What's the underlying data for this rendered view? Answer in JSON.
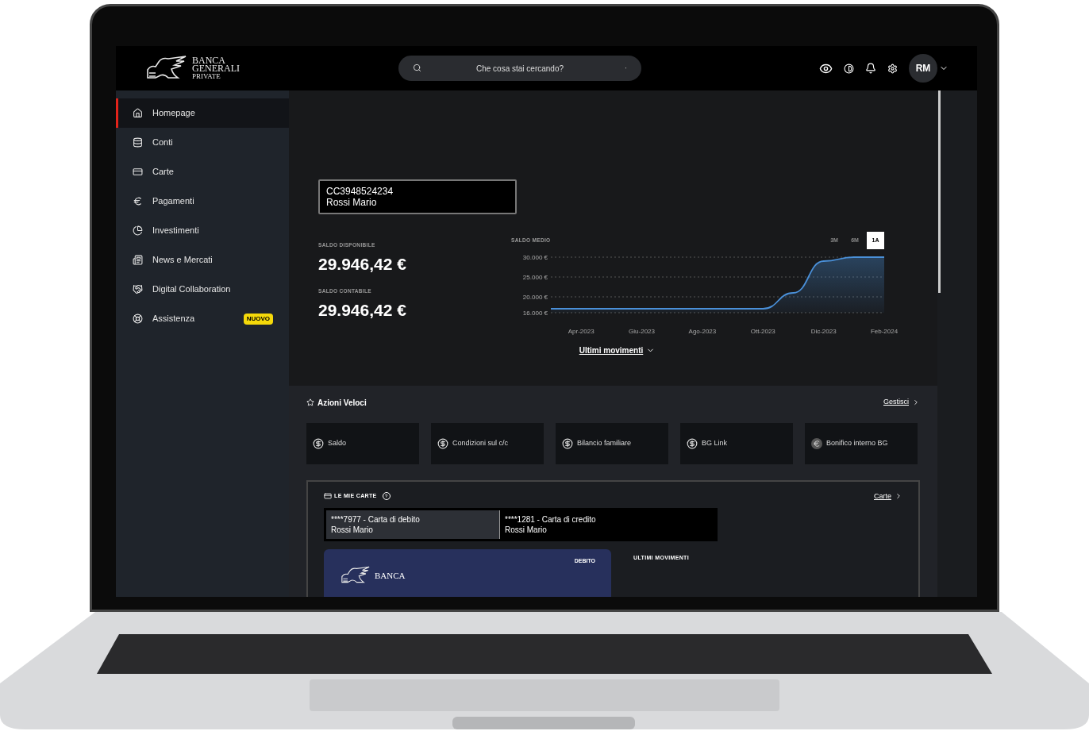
{
  "header": {
    "logo_lines": [
      "BANCA",
      "GENERALI",
      "PRIVATE"
    ],
    "search": {
      "placeholder": "Che cosa stai cercando?",
      "dot": "·"
    },
    "avatar": "RM"
  },
  "sidebar": {
    "items": [
      {
        "label": "Homepage",
        "selected": true
      },
      {
        "label": "Conti",
        "selected": false
      },
      {
        "label": "Carte",
        "selected": false
      },
      {
        "label": "Pagamenti",
        "selected": false
      },
      {
        "label": "Investimenti",
        "selected": false
      },
      {
        "label": "News e Mercati",
        "selected": false
      },
      {
        "label": "Digital Collaboration",
        "selected": false
      },
      {
        "label": "Assistenza",
        "selected": false,
        "badge": "NUOVO"
      }
    ]
  },
  "account": {
    "number": "CC3948524234",
    "holder": "Rossi Mario",
    "balances": [
      {
        "label": "SALDO DISPONIBILE",
        "value": "29.946,42 €"
      },
      {
        "label": "SALDO CONTABILE",
        "value": "29.946,42 €"
      }
    ],
    "chart_title": "SALDO MEDIO",
    "ranges": [
      {
        "label": "3M",
        "selected": false
      },
      {
        "label": "6M",
        "selected": false
      },
      {
        "label": "1A",
        "selected": true
      }
    ],
    "chart_data": {
      "type": "area",
      "categories": [
        null,
        "Apr-2023",
        null,
        "Giu-2023",
        null,
        "Ago-2023",
        null,
        "Ott-2023",
        null,
        "Dic-2023",
        null,
        "Feb-2024"
      ],
      "series": [
        {
          "color": "#4a90d9",
          "values": [
            17000,
            17000,
            17000,
            17000,
            17000,
            17000,
            17000,
            17000,
            21000,
            29000,
            30000,
            30000
          ]
        }
      ],
      "ylim": [
        16000,
        30000
      ],
      "yticks": [
        {
          "value": 16000,
          "label": "16.000 €"
        },
        {
          "value": 20000,
          "label": "20.000 €"
        },
        {
          "value": 25000,
          "label": "25.000 €"
        },
        {
          "value": 30000,
          "label": "30.000 €"
        }
      ]
    },
    "movements_link": "Ultimi movimenti"
  },
  "quick_actions": {
    "title": "Azioni Veloci",
    "manage": "Gestisci",
    "items": [
      {
        "label": "Saldo"
      },
      {
        "label": "Condizioni sul c/c"
      },
      {
        "label": "Bilancio familiare"
      },
      {
        "label": "BG Link"
      },
      {
        "label": "Bonifico interno BG"
      }
    ]
  },
  "cards": {
    "title": "LE MIE CARTE",
    "help": "?",
    "link": "Carte",
    "tabs": [
      {
        "number": "****7977 - Carta di debito",
        "holder": "Rossi Mario",
        "selected": true
      },
      {
        "number": "****1281 - Carta di credito",
        "holder": "Rossi Mario",
        "selected": false
      }
    ],
    "card_preview": {
      "brand": "BANCA",
      "type": "DEBITO"
    },
    "movements_title": "ULTIMI MOVIMENTI"
  }
}
